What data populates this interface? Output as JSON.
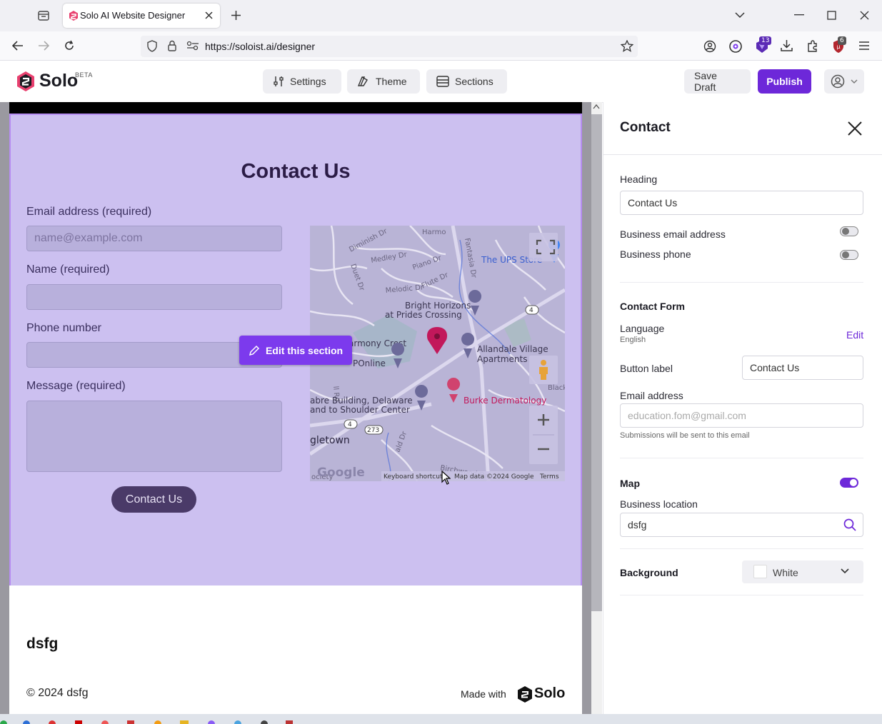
{
  "browser": {
    "tab_title": "Solo AI Website Designer",
    "url": "https://soloist.ai/designer",
    "ext_badge_1": "13",
    "ext_badge_2": "6"
  },
  "app": {
    "brand": "Solo",
    "beta": "BETA",
    "nav": {
      "settings": "Settings",
      "theme": "Theme",
      "sections": "Sections"
    },
    "save_draft": "Save Draft",
    "publish": "Publish"
  },
  "preview": {
    "contact_title": "Contact Us",
    "fields": {
      "email_label": "Email address (required)",
      "email_placeholder": "name@example.com",
      "name_label": "Name (required)",
      "phone_label": "Phone number",
      "message_label": "Message (required)"
    },
    "submit_label": "Contact Us",
    "edit_section": "Edit this section",
    "map": {
      "labels": [
        "Harmony Crest",
        "Bright Horizons",
        "at Prides Crossing",
        "Allandale Village",
        "Apartments",
        "The UPS Store",
        "Burke Dermatology",
        "abre Building, Delaware",
        "and to Shoulder Center",
        "gletown",
        "POnline",
        "Diminish Dr",
        "Medley Dr",
        "Piano Dr",
        "Flute Dr",
        "Melodic Dr",
        "Birchwood Dr",
        "Black",
        "Fantasia Dr",
        "Harmo",
        "Duet Dr",
        "ll Rd",
        "ald Dr",
        "ociety",
        "4",
        "273"
      ],
      "google": "Google",
      "keyboard": "Keyboard shortcuts",
      "map_data": "Map data ©2024 Google",
      "terms": "Terms"
    },
    "footer": {
      "title": "dsfg",
      "copyright": "© 2024 dsfg",
      "made_with": "Made with",
      "made_brand": "Solo"
    }
  },
  "panel": {
    "title": "Contact",
    "heading_label": "Heading",
    "heading_value": "Contact Us",
    "business_email": "Business email address",
    "business_email_on": false,
    "business_phone": "Business phone",
    "business_phone_on": false,
    "contact_form": "Contact Form",
    "language_label": "Language",
    "language_value": "English",
    "edit": "Edit",
    "button_label": "Button label",
    "button_label_value": "Contact Us",
    "email_address_label": "Email address",
    "email_placeholder": "education.fom@gmail.com",
    "email_hint": "Submissions will be sent to this email",
    "map_label": "Map",
    "map_on": true,
    "business_location_label": "Business location",
    "business_location_value": "dsfg",
    "background_label": "Background",
    "background_value": "White"
  },
  "colors": {
    "accent": "#6d28d9",
    "section_bg": "#ccc0f0",
    "map_pin": "#c2185b"
  }
}
